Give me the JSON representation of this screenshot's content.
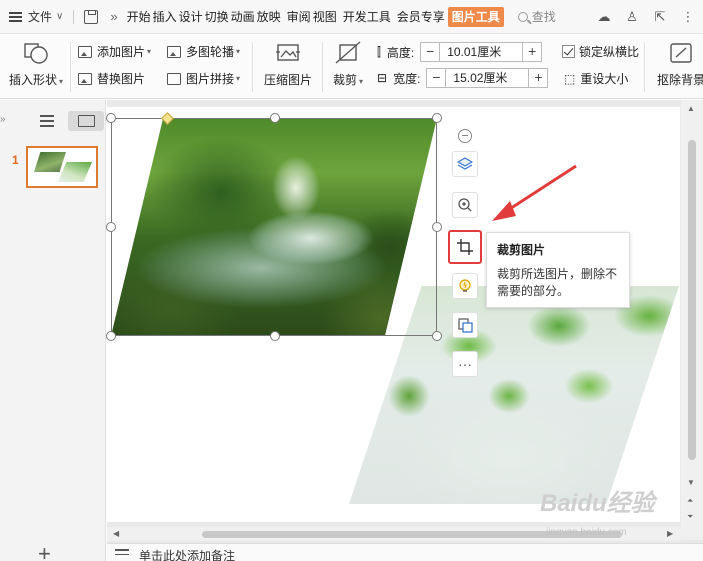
{
  "menubar": {
    "file_label": "文件",
    "tabs": [
      "开始",
      "插入",
      "设计",
      "切换",
      "动画",
      "放映",
      "审阅",
      "视图",
      "开发工具",
      "会员专享"
    ],
    "active_tab": "图片工具",
    "search_label": "查找"
  },
  "ribbon": {
    "insert_shape": "插入形状",
    "add_picture": "添加图片",
    "replace_picture": "替换图片",
    "multi_carousel": "多图轮播",
    "picture_stitch": "图片拼接",
    "compress_picture": "压缩图片",
    "crop": "裁剪",
    "height_label": "高度:",
    "height_value": "10.01厘米",
    "width_label": "宽度:",
    "width_value": "15.02厘米",
    "lock_ratio": "锁定纵横比",
    "reset_size": "重设大小",
    "remove_bg": "抠除背景"
  },
  "sidebar": {
    "slide_number": "1"
  },
  "tooltip": {
    "title": "裁剪图片",
    "body": "裁剪所选图片，删除不需要的部分。"
  },
  "notes": {
    "placeholder": "单击此处添加备注"
  },
  "watermark": {
    "brand": "Baidu经验",
    "url": "jingyan.baidu.com"
  },
  "colors": {
    "active_tab_bg": "#f08a4b",
    "highlight_red": "#e23b3b",
    "slide_thumb_border": "#e07a30"
  }
}
